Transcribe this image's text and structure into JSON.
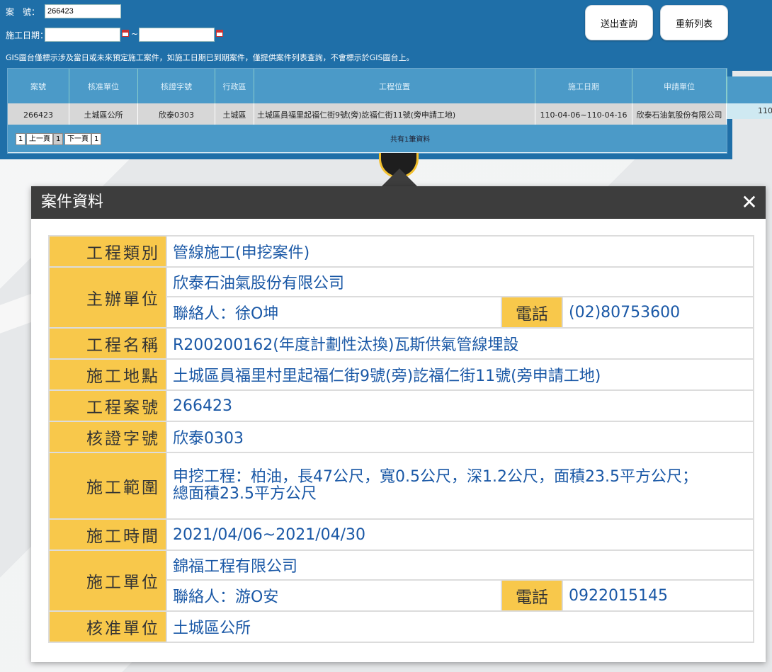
{
  "search": {
    "case_no_label": "案　號：",
    "case_no_value": "266423",
    "date_label": "施工日期：",
    "date_sep": "~",
    "submit_label": "送出查詢",
    "reset_label": "重新列表",
    "notice": "GIS圖台僅標示涉及當日或未來預定施工案件，如施工日期已到期案件，僅提供案件列表查詢，不會標示於GIS圖台上。"
  },
  "results": {
    "headers": [
      "案號",
      "核准單位",
      "核證字號",
      "行政區",
      "工程位置",
      "施工日期",
      "申請單位"
    ],
    "row": [
      "266423",
      "土城區公所",
      "欣泰0303",
      "土城區",
      "土城區員福里起福仁街9號(旁)訖福仁街11號(旁申請工地)",
      "110-04-06~110-04-16",
      "欣泰石油氣股份有限公司"
    ],
    "pager": [
      "1",
      "上一頁",
      "1",
      "下一頁",
      "1"
    ],
    "total": "共有1筆資料",
    "right_cell": "110"
  },
  "modal": {
    "title": "案件資料",
    "close": "✕",
    "rows": {
      "category_k": "工程類別",
      "category_v": "管線施工(申挖案件)",
      "organizer_k": "主辦單位",
      "organizer_v": "欣泰石油氣股份有限公司",
      "organizer_contact": "聯絡人：徐O坤",
      "organizer_phone_k": "電話",
      "organizer_phone_v": "(02)80753600",
      "name_k": "工程名稱",
      "name_v": "R200200162(年度計劃性汰換)瓦斯供氣管線埋設",
      "location_k": "施工地點",
      "location_v": "土城區員福里村里起福仁街9號(旁)訖福仁街11號(旁申請工地)",
      "caseno_k": "工程案號",
      "caseno_v": "266423",
      "permit_k": "核證字號",
      "permit_v": "欣泰0303",
      "scope_k": "施工範圍",
      "scope_v1": "申挖工程：柏油，長47公尺，寬0.5公尺，深1.2公尺，面積23.5平方公尺；",
      "scope_v2": "總面積23.5平方公尺",
      "time_k": "施工時間",
      "time_v": "2021/04/06~2021/04/30",
      "contractor_k": "施工單位",
      "contractor_v": "錦福工程有限公司",
      "contractor_contact": "聯絡人：游O安",
      "contractor_phone_k": "電話",
      "contractor_phone_v": "0922015145",
      "approve_k": "核准單位",
      "approve_v": "土城區公所"
    }
  }
}
